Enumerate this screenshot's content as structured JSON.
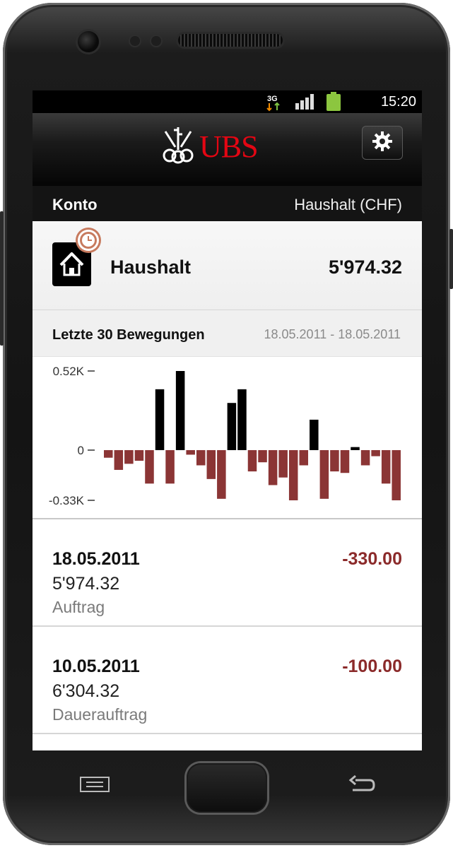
{
  "status": {
    "network": "3G",
    "time": "15:20"
  },
  "header": {
    "brand": "UBS",
    "settings_icon": "gear-icon"
  },
  "account_bar": {
    "left_label": "Konto",
    "right_label": "Haushalt (CHF)"
  },
  "account": {
    "name": "Haushalt",
    "balance": "5'974.32",
    "icon": "house-icon",
    "badge": "clock-icon"
  },
  "movements": {
    "title": "Letzte 30 Bewegungen",
    "range": "18.05.2011 - 18.05.2011"
  },
  "chart_data": {
    "type": "bar",
    "ylim": [
      -0.33,
      0.52
    ],
    "ytick_labels": [
      "0.52K",
      "0",
      "-0.33K"
    ],
    "ytick_values": [
      0.52,
      0,
      -0.33
    ],
    "values": [
      -0.05,
      -0.13,
      -0.09,
      -0.07,
      -0.22,
      0.4,
      -0.22,
      0.52,
      -0.03,
      -0.1,
      -0.19,
      -0.32,
      0.31,
      0.4,
      -0.14,
      -0.08,
      -0.23,
      -0.18,
      -0.33,
      -0.1,
      0.2,
      -0.32,
      -0.14,
      -0.15,
      0.02,
      -0.1,
      -0.04,
      -0.22,
      -0.33
    ],
    "colors": {
      "positive": "#000000",
      "negative": "#8b3535"
    }
  },
  "transactions": [
    {
      "date": "18.05.2011",
      "amount": "-330.00",
      "balance": "5'974.32",
      "type": "Auftrag"
    },
    {
      "date": "10.05.2011",
      "amount": "-100.00",
      "balance": "6'304.32",
      "type": "Dauerauftrag"
    }
  ],
  "nav": {
    "menu_icon": "menu-icon",
    "home_icon": "home-button",
    "back_icon": "back-icon"
  }
}
